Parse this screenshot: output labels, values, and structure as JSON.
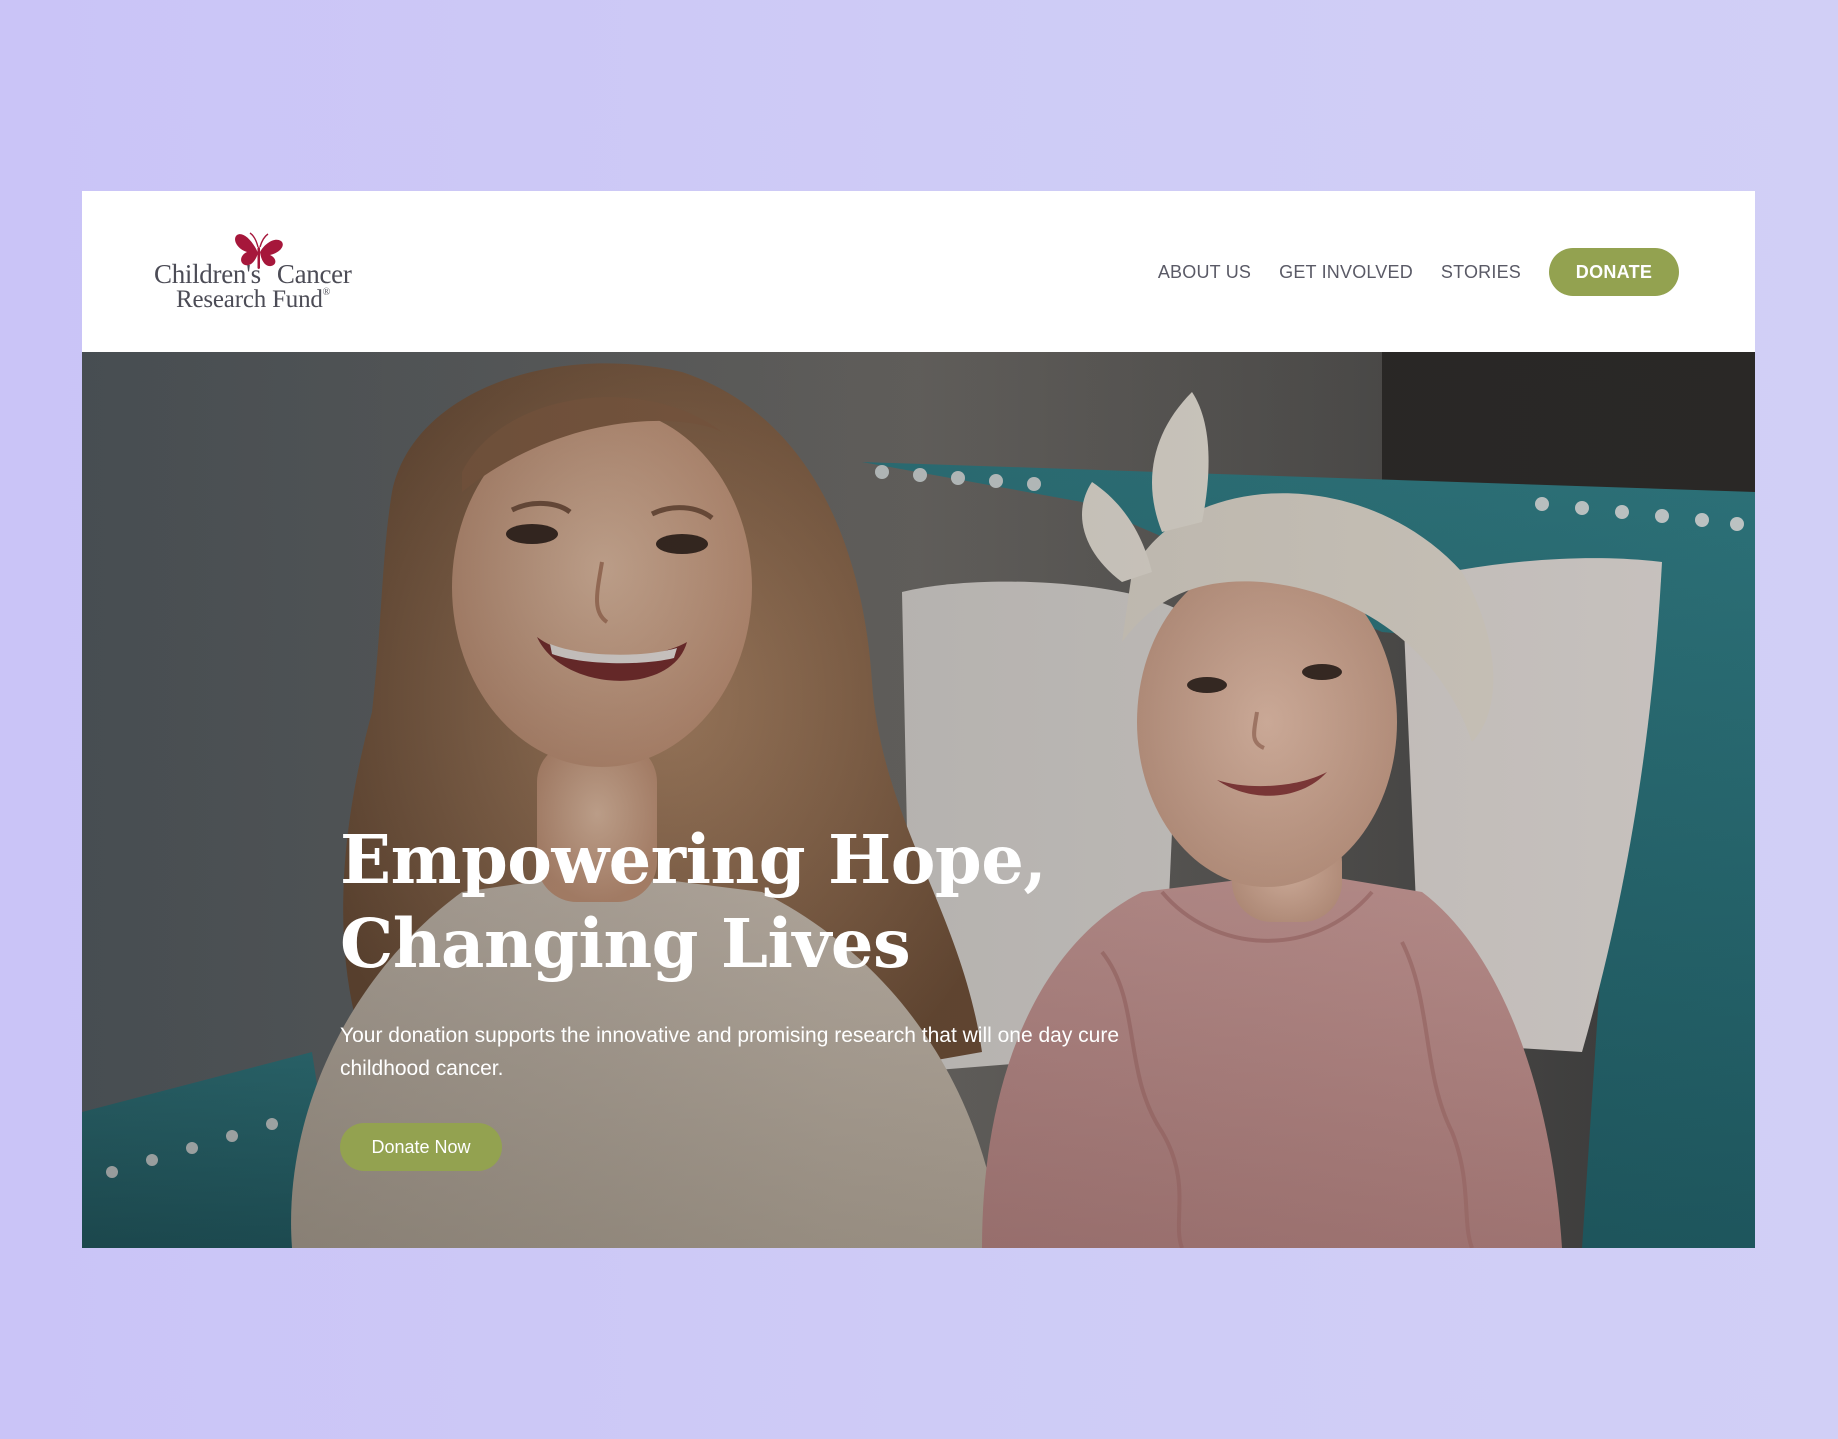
{
  "brand": {
    "logo_line1_a": "Children's",
    "logo_line1_b": "Cancer",
    "logo_line2": "Research Fund",
    "logo_mark": "®",
    "logo_icon": "butterfly-icon",
    "logo_color": "#a6173b"
  },
  "nav": {
    "items": [
      {
        "label": "ABOUT US"
      },
      {
        "label": "GET INVOLVED"
      },
      {
        "label": "STORIES"
      }
    ],
    "donate_label": "DONATE"
  },
  "hero": {
    "title_line1": "Empowering Hope,",
    "title_line2": "Changing Lives",
    "subtitle": "Your donation supports the innovative and promising research that will one day cure childhood cancer.",
    "cta_label": "Donate Now"
  },
  "colors": {
    "accent": "#93a250",
    "page_background": "#cac4f7",
    "nav_text": "#5a5a66"
  }
}
